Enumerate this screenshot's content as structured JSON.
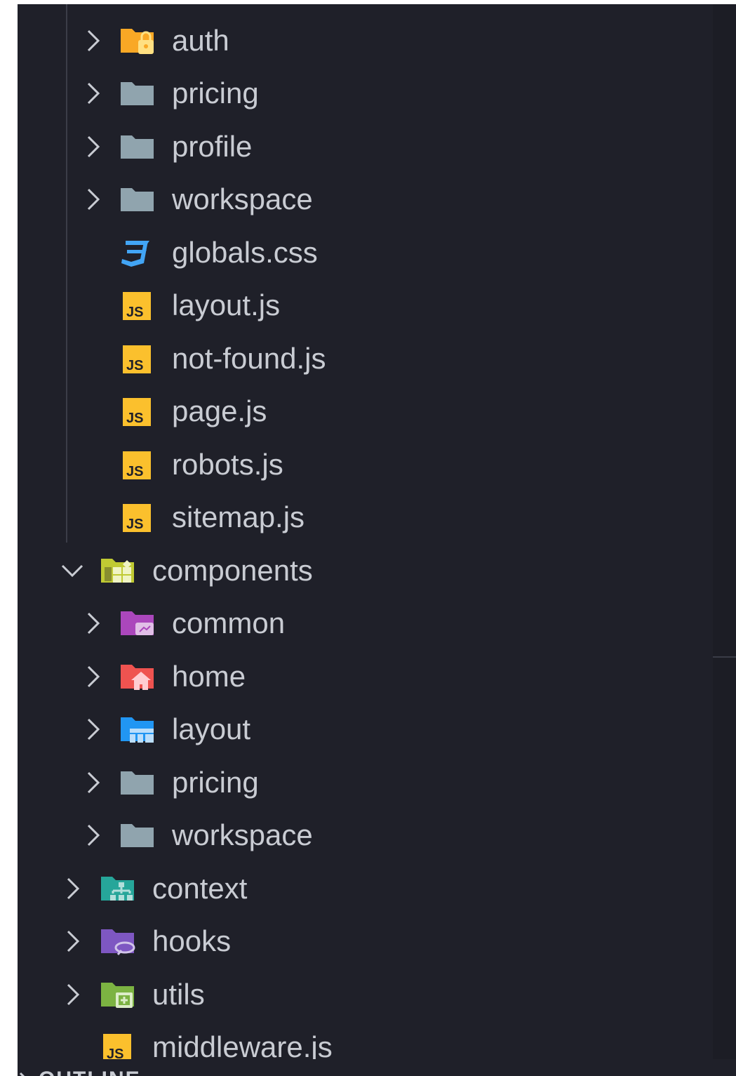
{
  "explorer": {
    "items": [
      {
        "label": "auth",
        "icon": "folder-auth-icon",
        "kind": "folder",
        "expanded": false
      },
      {
        "label": "pricing",
        "icon": "folder-icon",
        "kind": "folder",
        "expanded": false
      },
      {
        "label": "profile",
        "icon": "folder-icon",
        "kind": "folder",
        "expanded": false
      },
      {
        "label": "workspace",
        "icon": "folder-icon",
        "kind": "folder",
        "expanded": false
      },
      {
        "label": "globals.css",
        "icon": "css-file-icon",
        "kind": "file"
      },
      {
        "label": "layout.js",
        "icon": "js-file-icon",
        "kind": "file"
      },
      {
        "label": "not-found.js",
        "icon": "js-file-icon",
        "kind": "file"
      },
      {
        "label": "page.js",
        "icon": "js-file-icon",
        "kind": "file"
      },
      {
        "label": "robots.js",
        "icon": "js-file-icon",
        "kind": "file"
      },
      {
        "label": "sitemap.js",
        "icon": "js-file-icon",
        "kind": "file"
      },
      {
        "label": "components",
        "icon": "folder-components-icon",
        "kind": "folder",
        "expanded": true
      },
      {
        "label": "common",
        "icon": "folder-common-icon",
        "kind": "folder",
        "expanded": false
      },
      {
        "label": "home",
        "icon": "folder-home-icon",
        "kind": "folder",
        "expanded": false
      },
      {
        "label": "layout",
        "icon": "folder-layout-icon",
        "kind": "folder",
        "expanded": false
      },
      {
        "label": "pricing",
        "icon": "folder-icon",
        "kind": "folder",
        "expanded": false
      },
      {
        "label": "workspace",
        "icon": "folder-icon",
        "kind": "folder",
        "expanded": false
      },
      {
        "label": "context",
        "icon": "folder-context-icon",
        "kind": "folder",
        "expanded": false
      },
      {
        "label": "hooks",
        "icon": "folder-hooks-icon",
        "kind": "folder",
        "expanded": false
      },
      {
        "label": "utils",
        "icon": "folder-utils-icon",
        "kind": "folder",
        "expanded": false
      },
      {
        "label": "middleware.js",
        "icon": "js-file-icon",
        "kind": "file"
      }
    ]
  },
  "outline": {
    "label": "OUTLINE"
  },
  "colors": {
    "background": "#1f2029",
    "text": "#c9ccd3",
    "folder_default": "#90a4ae",
    "folder_auth": "#f9a825",
    "css": "#42a5f5",
    "js": "#fbc02d",
    "folder_components": "#c0ca33",
    "folder_common": "#ab47bc",
    "folder_home": "#ef5350",
    "folder_layout": "#2196f3",
    "folder_context": "#26a69a",
    "folder_hooks": "#7e57c2",
    "folder_utils": "#7cb342"
  }
}
